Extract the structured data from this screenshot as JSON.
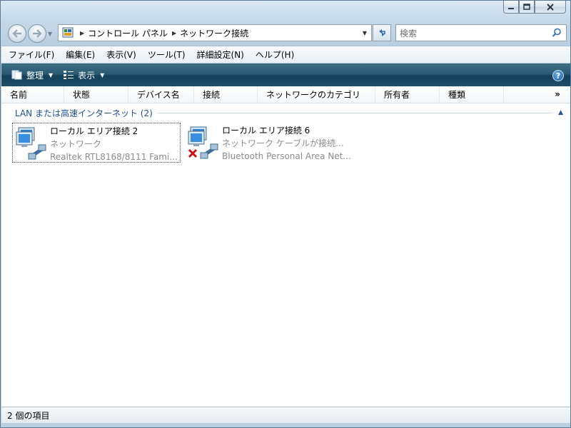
{
  "breadcrumb": {
    "items": [
      "コントロール パネル",
      "ネットワーク接続"
    ]
  },
  "search": {
    "placeholder": "検索"
  },
  "menubar": {
    "items": [
      "ファイル(F)",
      "編集(E)",
      "表示(V)",
      "ツール(T)",
      "詳細設定(N)",
      "ヘルプ(H)"
    ]
  },
  "toolbar": {
    "organize_label": "整理",
    "view_label": "表示",
    "help_label": "?"
  },
  "columns": [
    "名前",
    "状態",
    "デバイス名",
    "接続",
    "ネットワークのカテゴリ",
    "所有者",
    "種類"
  ],
  "group": {
    "title": "LAN または高速インターネット (2)"
  },
  "connections": [
    {
      "name": "ローカル エリア接続 2",
      "status": "ネットワーク",
      "device": "Realtek RTL8168/8111 Fami..."
    },
    {
      "name": "ローカル エリア接続 6",
      "status": "ネットワーク ケーブルが接続...",
      "device": "Bluetooth Personal Area Net..."
    }
  ],
  "statusbar": {
    "text": "2 個の項目"
  },
  "colors": {
    "toolbar_bg": "#13405a",
    "group_text": "#1d4f9b",
    "muted_text": "#8b8b8b",
    "error_x": "#d01010"
  }
}
